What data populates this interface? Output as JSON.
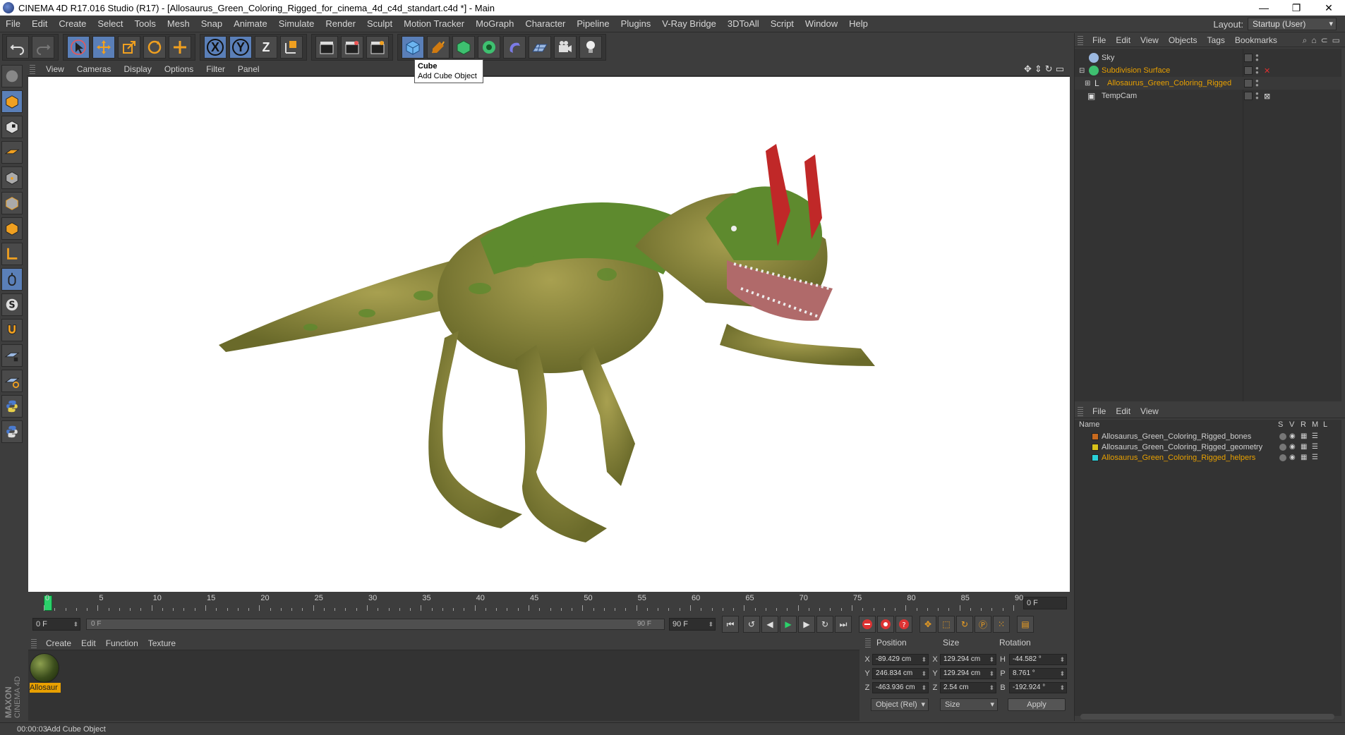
{
  "window": {
    "title": "CINEMA 4D R17.016 Studio (R17) - [Allosaurus_Green_Coloring_Rigged_for_cinema_4d_c4d_standart.c4d *] - Main",
    "controls": [
      "—",
      "❐",
      "✕"
    ]
  },
  "menubar": {
    "items": [
      "File",
      "Edit",
      "Create",
      "Select",
      "Tools",
      "Mesh",
      "Snap",
      "Animate",
      "Simulate",
      "Render",
      "Sculpt",
      "Motion Tracker",
      "MoGraph",
      "Character",
      "Pipeline",
      "Plugins",
      "V-Ray Bridge",
      "3DToAll",
      "Script",
      "Window",
      "Help"
    ],
    "layout_label": "Layout:",
    "layout_value": "Startup (User)"
  },
  "toolbar": {
    "axis_x": "X",
    "axis_y": "Y",
    "axis_z": "Z"
  },
  "tooltip": {
    "title": "Cube",
    "text": "Add Cube Object"
  },
  "viewport": {
    "menu": [
      "View",
      "Cameras",
      "Display",
      "Options",
      "Filter",
      "Panel"
    ]
  },
  "timeline": {
    "labels": [
      "0",
      "5",
      "10",
      "15",
      "20",
      "25",
      "30",
      "35",
      "40",
      "45",
      "50",
      "55",
      "60",
      "65",
      "70",
      "75",
      "80",
      "85",
      "90"
    ],
    "end_field": "0 F"
  },
  "transport": {
    "start_field": "0 F",
    "slider_left": "0 F",
    "slider_right": "90 F",
    "end_field": "90 F"
  },
  "materials": {
    "menu": [
      "Create",
      "Edit",
      "Function",
      "Texture"
    ],
    "items": [
      {
        "name": "Allosaur"
      }
    ]
  },
  "coords": {
    "headers": {
      "position": "Position",
      "size": "Size",
      "rotation": "Rotation"
    },
    "rows": [
      {
        "axis": "X",
        "pos": "-89.429 cm",
        "saxis": "X",
        "size": "129.294 cm",
        "raxis": "H",
        "rot": "-44.582 °"
      },
      {
        "axis": "Y",
        "pos": "246.834 cm",
        "saxis": "Y",
        "size": "129.294 cm",
        "raxis": "P",
        "rot": "8.761 °"
      },
      {
        "axis": "Z",
        "pos": "-463.936 cm",
        "saxis": "Z",
        "size": "2.54 cm",
        "raxis": "B",
        "rot": "-192.924 °"
      }
    ],
    "mode": "Object (Rel)",
    "size_mode": "Size",
    "apply": "Apply"
  },
  "status": {
    "time": "00:00:03",
    "message": "Add Cube Object"
  },
  "objects_panel": {
    "menu": [
      "File",
      "Edit",
      "View",
      "Objects",
      "Tags",
      "Bookmarks"
    ],
    "items": [
      {
        "name": "Sky",
        "color": "#d0d0d0"
      },
      {
        "name": "Subdivision Surface",
        "color": "#e8a000"
      },
      {
        "name": "Allosaurus_Green_Coloring_Rigged",
        "color": "#e8a000"
      },
      {
        "name": "TempCam",
        "color": "#d0d0d0"
      }
    ]
  },
  "layers_panel": {
    "menu": [
      "File",
      "Edit",
      "View"
    ],
    "header": {
      "name": "Name",
      "s": "S",
      "v": "V",
      "r": "R",
      "m": "M",
      "l": "L"
    },
    "items": [
      {
        "name": "Allosaurus_Green_Coloring_Rigged_bones",
        "swatch": "#c86a1e",
        "color": "#d0d0d0"
      },
      {
        "name": "Allosaurus_Green_Coloring_Rigged_geometry",
        "swatch": "#d8c21a",
        "color": "#d0d0d0"
      },
      {
        "name": "Allosaurus_Green_Coloring_Rigged_helpers",
        "swatch": "#2ad0d8",
        "color": "#e8a000"
      }
    ]
  },
  "logo": {
    "text1": "MAXON",
    "text2": "CINEMA 4D"
  }
}
